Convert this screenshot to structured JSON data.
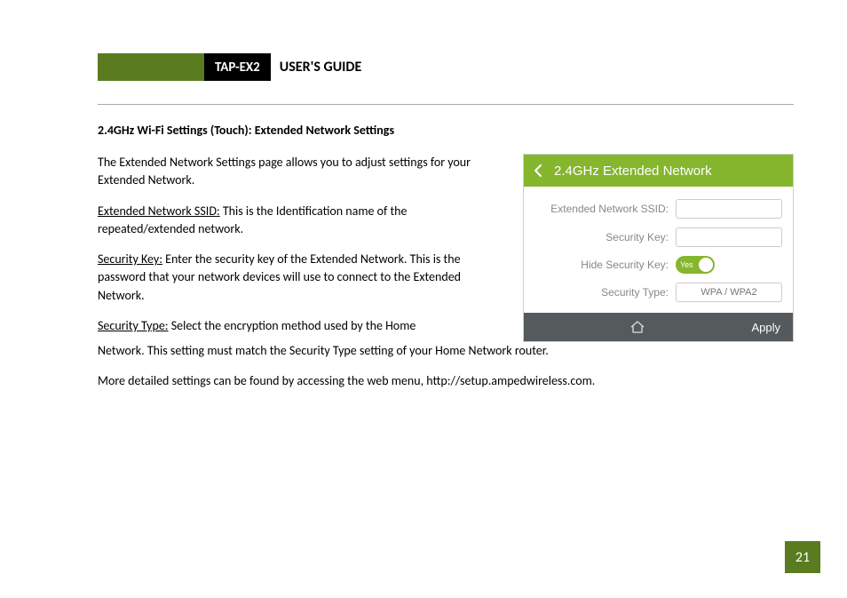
{
  "header": {
    "product": "TAP-EX2",
    "guide": "USER'S GUIDE"
  },
  "section_heading": "2.4GHz Wi-Fi Settings (Touch): Extended Network Settings",
  "paras": {
    "intro": "The Extended Network Settings page allows you to adjust settings for your Extended Network.",
    "ssid_label": "Extended Network SSID:",
    "ssid_text": " This is the Identification name of the repeated/extended network.",
    "seckey_label": "Security Key:",
    "seckey_text": " Enter the security key of the Extended Network. This is the password that your network devices will use to connect to the Extended Network.",
    "sectype_label": "Security Type:",
    "sectype_text_a": " Select the encryption method used by the Home",
    "sectype_text_b": "Network. This setting must match the Security Type setting of your Home Network router.",
    "more": "More detailed settings can be found by accessing the web menu, http://setup.ampedwireless.com."
  },
  "device": {
    "title": "2.4GHz Extended Network",
    "labels": {
      "ssid": "Extended Network SSID:",
      "seckey": "Security Key:",
      "hidekey": "Hide Security Key:",
      "sectype": "Security Type:"
    },
    "toggle_text": "Yes",
    "sectype_value": "WPA / WPA2",
    "apply": "Apply"
  },
  "page_number": "21"
}
